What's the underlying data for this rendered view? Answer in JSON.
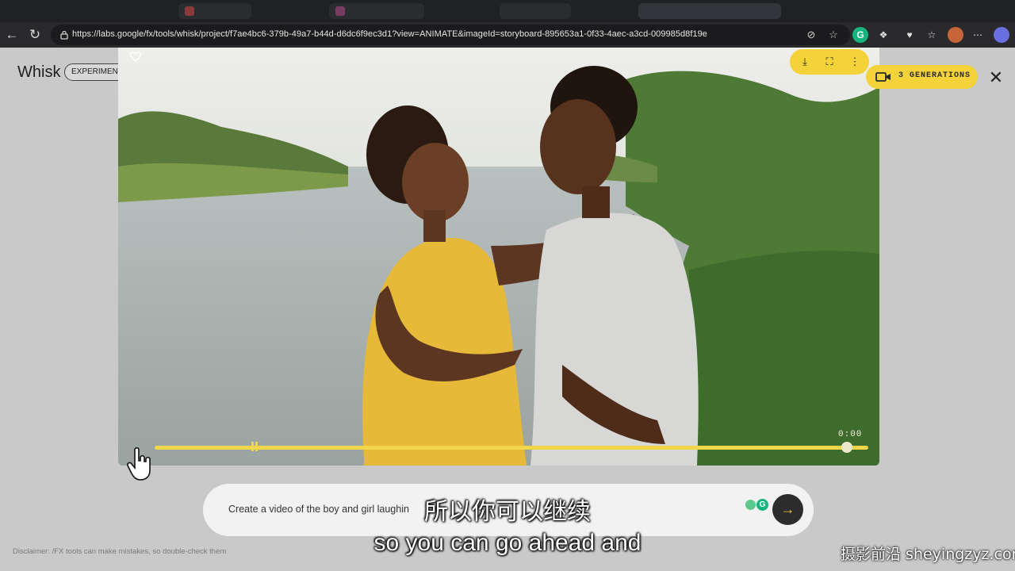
{
  "browser": {
    "url": "https://labs.google/fx/tools/whisk/project/f7ae4bc6-379b-49a7-b44d-d6dc6f9ec3d1?view=ANIMATE&imageId=storyboard-895653a1-0f33-4aec-a3cd-009985d8f19e"
  },
  "app": {
    "title": "Whisk",
    "badge": "EXPERIMENT"
  },
  "viewer": {
    "generations_label": "3 GENERATIONS",
    "time": "0:00",
    "progress": 0.97
  },
  "prompt": {
    "text": "Create a video of the boy and girl laughin"
  },
  "disclaimer": "Disclaimer: /FX tools can make mistakes, so double-check them",
  "subtitles": {
    "chinese": "所以你可以继续",
    "english": "so you can go ahead and"
  },
  "watermark": "摄影前沿 sheyingzyz.com",
  "colors": {
    "accent": "#f3d23a",
    "page_bg": "#c9c9c9",
    "send_button": "#2c2c2c"
  }
}
